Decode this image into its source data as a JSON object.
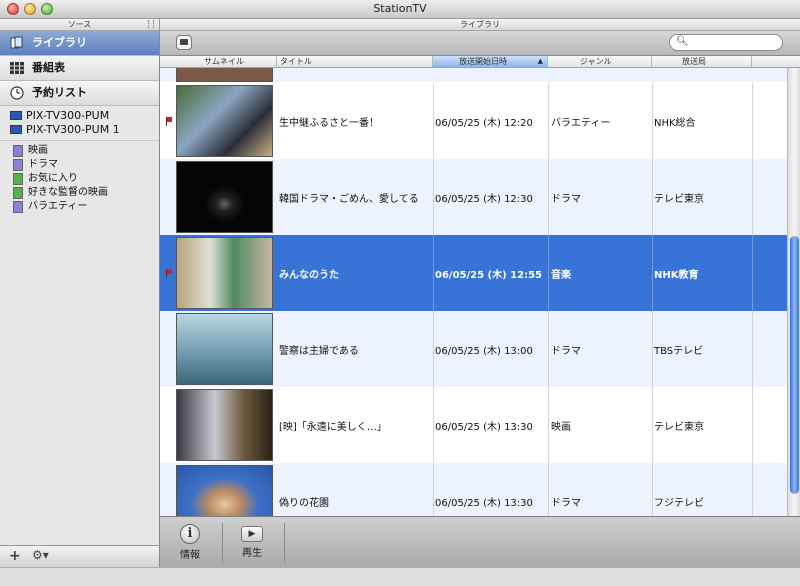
{
  "window": {
    "title": "StationTV"
  },
  "source_header": "ソース",
  "library_header": "ライブラリ",
  "sidebar": {
    "nav": [
      {
        "label": "ライブラリ",
        "icon": "library-icon",
        "selected": true
      },
      {
        "label": "番組表",
        "icon": "program-guide-icon",
        "selected": false
      },
      {
        "label": "予約リスト",
        "icon": "clock-icon",
        "selected": false
      }
    ],
    "devices": [
      {
        "label": "PIX-TV300-PUM"
      },
      {
        "label": "PIX-TV300-PUM 1"
      }
    ],
    "folders": [
      {
        "label": "映画",
        "color": "purple"
      },
      {
        "label": "ドラマ",
        "color": "purple"
      },
      {
        "label": "お気に入り",
        "color": "green"
      },
      {
        "label": "好きな監督の映画",
        "color": "green"
      },
      {
        "label": "バラエティー",
        "color": "purple"
      }
    ]
  },
  "search": {
    "placeholder": ""
  },
  "table": {
    "columns": [
      "サムネイル",
      "タイトル",
      "放送開始日時",
      "ジャンル",
      "放送局"
    ],
    "sorted_column": "放送開始日時",
    "rows": [
      {
        "flag": true,
        "title": "生中継ふるさと一番！",
        "datetime": "06/05/25 (木) 12:20",
        "genre": "バラエティー",
        "station": "NHK総合",
        "selected": false,
        "thumb": "#5a6b5f"
      },
      {
        "flag": false,
        "title": "韓国ドラマ・ごめん、愛してる",
        "datetime": "06/05/25 (木) 12:30",
        "genre": "ドラマ",
        "station": "テレビ東京",
        "selected": false,
        "thumb": "#050505"
      },
      {
        "flag": true,
        "title": "みんなのうた",
        "datetime": "06/05/25 (木) 12:55",
        "genre": "音楽",
        "station": "NHK教育",
        "selected": true,
        "thumb": "#7fa09a"
      },
      {
        "flag": false,
        "title": "警察は主婦である",
        "datetime": "06/05/25 (木) 13:00",
        "genre": "ドラマ",
        "station": "TBSテレビ",
        "selected": false,
        "thumb": "#9ec3cf"
      },
      {
        "flag": false,
        "title": "[映]「永遠に美しく…」",
        "datetime": "06/05/25 (木) 13:30",
        "genre": "映画",
        "station": "テレビ東京",
        "selected": false,
        "thumb": "#5a4e3e"
      },
      {
        "flag": false,
        "title": "偽りの花園",
        "datetime": "06/05/25 (木) 13:30",
        "genre": "ドラマ",
        "station": "フジテレビ",
        "selected": false,
        "thumb": "#3c70c8"
      }
    ]
  },
  "bottom": {
    "info_label": "情報",
    "play_label": "再生"
  }
}
